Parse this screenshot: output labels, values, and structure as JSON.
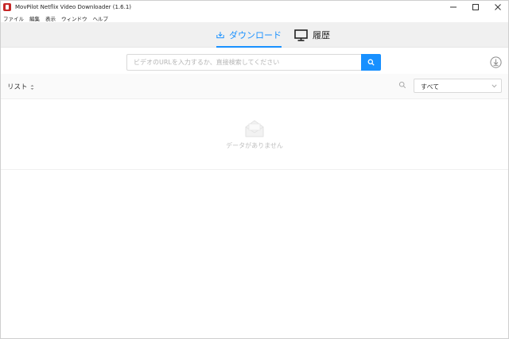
{
  "window": {
    "title": "MovPilot Netflix Video Downloader (1.6.1)"
  },
  "menu": {
    "items": [
      {
        "label": "ファイル"
      },
      {
        "label": "編集"
      },
      {
        "label": "表示"
      },
      {
        "label": "ウィンドウ"
      },
      {
        "label": "ヘルプ"
      }
    ]
  },
  "tabs": {
    "download": {
      "label": "ダウンロード",
      "icon": "download-tray-icon",
      "active": true
    },
    "history": {
      "label": "履歴",
      "icon": "monitor-icon",
      "active": false
    }
  },
  "search": {
    "placeholder": "ビデオのURLを入力するか、直接検索してください",
    "value": ""
  },
  "list": {
    "label": "リスト",
    "filter": {
      "selected": "すべて"
    }
  },
  "empty": {
    "text": "データがありません"
  },
  "colors": {
    "accent": "#1890ff",
    "header_bg": "#f0f0f0",
    "app_icon": "#c62828"
  }
}
